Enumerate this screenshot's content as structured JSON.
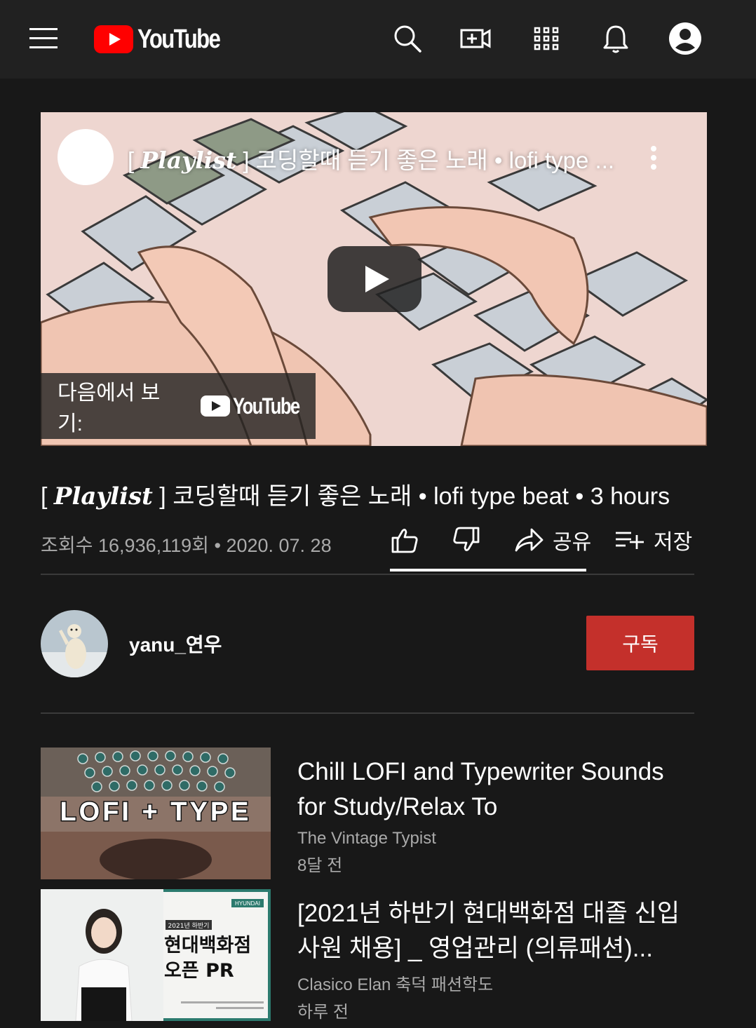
{
  "header": {
    "logo_text": "YouTube",
    "icons": [
      "menu-icon",
      "search-icon",
      "create-video-icon",
      "apps-icon",
      "notifications-icon",
      "account-icon"
    ]
  },
  "player": {
    "title": "[ Playlist ] 코딩할때 듣기 좋은 노래 • lofi type ...",
    "title_playlist": "Playlist",
    "title_rest": " ] 코딩할때 듣기 좋은 노래 • lofi type ...",
    "watch_on_label": "다음에서 보기:",
    "watch_on_brand": "YouTube"
  },
  "video": {
    "title_open": "[ ",
    "title_playlist": "Playlist",
    "title_rest": " ] 코딩할때 듣기 좋은 노래 • lofi type beat • 3 hours",
    "views": "조회수 16,936,119회 • 2020. 07. 28",
    "share_label": "공유",
    "save_label": "저장"
  },
  "channel": {
    "name": "yanu_연우",
    "subscribe_label": "구독"
  },
  "recommendations": [
    {
      "title": "Chill LOFI and Typewriter Sounds for Study/Relax To",
      "channel": "The Vintage Typist",
      "time": "8달 전",
      "thumb_text": "LOFI + TYPE"
    },
    {
      "title": "[2021년 하반기 현대백화점 대졸 신입사원 채용] _ 영업관리 (의류패션)...",
      "channel": "Clasico Elan 축덕 패션학도",
      "time": "하루 전",
      "thumb_badge": "2021년 하반기",
      "thumb_line1": "현대백화점",
      "thumb_line2": "오픈 PR",
      "thumb_brand": "HYUNDAI"
    }
  ],
  "colors": {
    "background": "#181818",
    "header": "#212121",
    "subscribe": "#c4302b",
    "brand_red": "#ff0000"
  }
}
